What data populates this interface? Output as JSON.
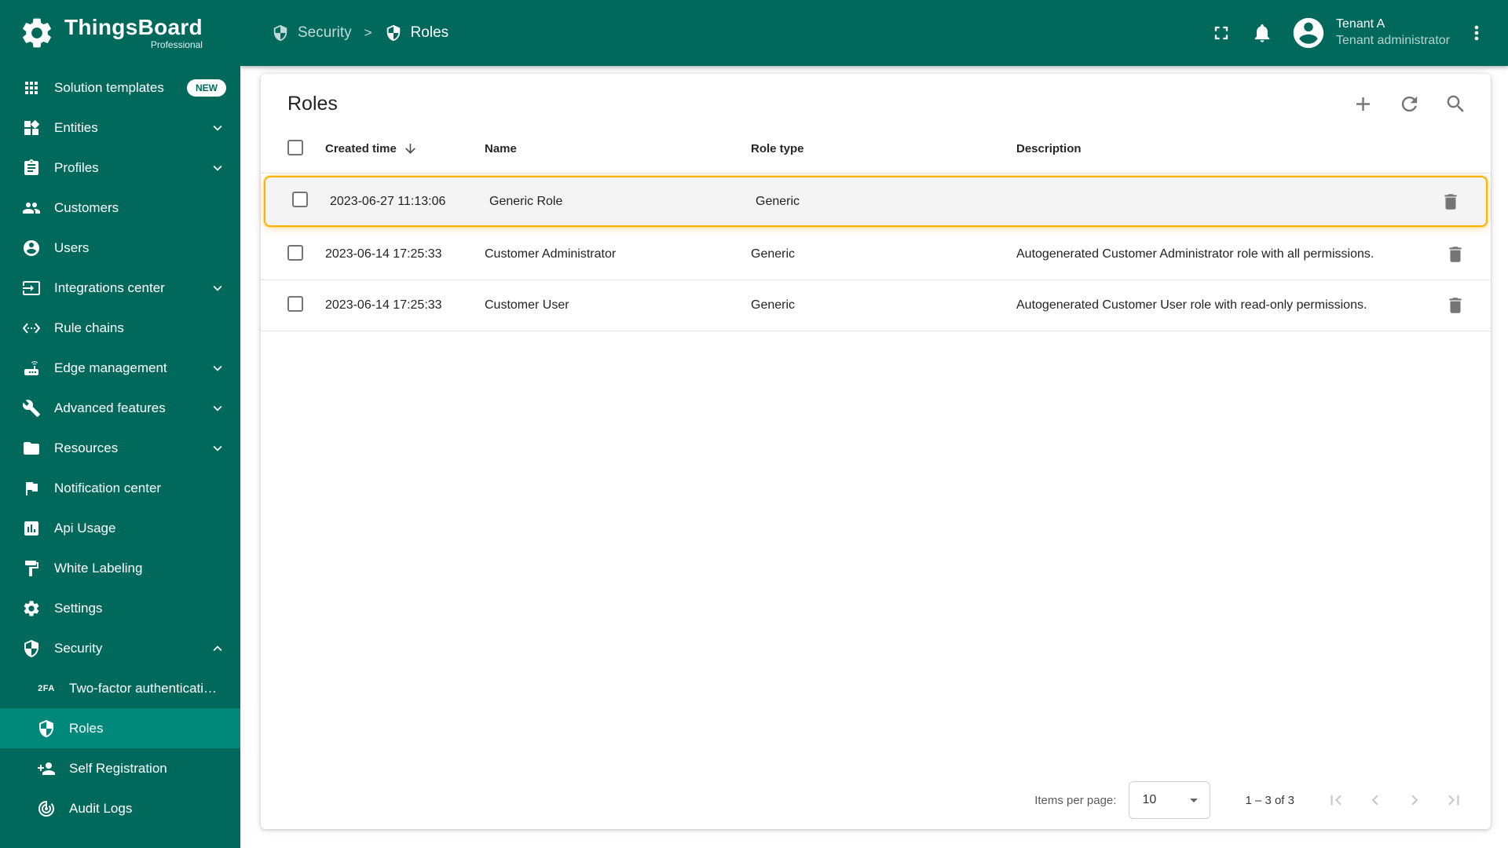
{
  "brand": {
    "name": "ThingsBoard",
    "subtitle": "Professional"
  },
  "header": {
    "breadcrumb": [
      {
        "label": "Security",
        "icon": "shield-icon"
      },
      {
        "label": "Roles",
        "icon": "shield-icon"
      }
    ],
    "separator": ">",
    "user": {
      "name": "Tenant A",
      "role": "Tenant administrator"
    }
  },
  "sidebar": {
    "items": [
      {
        "label": "Solution templates",
        "icon": "grid-icon",
        "badge": "NEW"
      },
      {
        "label": "Entities",
        "icon": "widgets-icon",
        "chevron": "down"
      },
      {
        "label": "Profiles",
        "icon": "assignment-icon",
        "chevron": "down"
      },
      {
        "label": "Customers",
        "icon": "people-icon"
      },
      {
        "label": "Users",
        "icon": "account-icon"
      },
      {
        "label": "Integrations center",
        "icon": "input-icon",
        "chevron": "down"
      },
      {
        "label": "Rule chains",
        "icon": "ethernet-icon"
      },
      {
        "label": "Edge management",
        "icon": "router-icon",
        "chevron": "down"
      },
      {
        "label": "Advanced features",
        "icon": "wrench-icon",
        "chevron": "down"
      },
      {
        "label": "Resources",
        "icon": "folder-icon",
        "chevron": "down"
      },
      {
        "label": "Notification center",
        "icon": "flag-icon"
      },
      {
        "label": "Api Usage",
        "icon": "chart-icon"
      },
      {
        "label": "White Labeling",
        "icon": "paint-icon"
      },
      {
        "label": "Settings",
        "icon": "gear-icon"
      },
      {
        "label": "Security",
        "icon": "shield-icon",
        "chevron": "up",
        "expanded": true,
        "sub": [
          {
            "label": "Two-factor authenticati…",
            "icon": "2fa-icon"
          },
          {
            "label": "Roles",
            "icon": "shield-icon",
            "active": true
          },
          {
            "label": "Self Registration",
            "icon": "person-add-icon"
          },
          {
            "label": "Audit Logs",
            "icon": "track-changes-icon"
          }
        ]
      }
    ]
  },
  "page": {
    "title": "Roles",
    "table": {
      "columns": [
        "Created time",
        "Name",
        "Role type",
        "Description"
      ],
      "sorted_column": "Created time",
      "sort_direction": "desc",
      "rows": [
        {
          "created": "2023-06-27 11:13:06",
          "name": "Generic Role",
          "type": "Generic",
          "description": "",
          "highlighted": true
        },
        {
          "created": "2023-06-14 17:25:33",
          "name": "Customer Administrator",
          "type": "Generic",
          "description": "Autogenerated Customer Administrator role with all permissions.",
          "highlighted": false
        },
        {
          "created": "2023-06-14 17:25:33",
          "name": "Customer User",
          "type": "Generic",
          "description": "Autogenerated Customer User role with read-only permissions.",
          "highlighted": false
        }
      ]
    },
    "pagination": {
      "items_per_page_label": "Items per page:",
      "page_size": "10",
      "range": "1 – 3 of 3"
    }
  },
  "icons": {
    "toolbar": [
      "add-icon",
      "refresh-icon",
      "search-icon"
    ],
    "row_action": "delete-icon",
    "topbar": [
      "fullscreen-icon",
      "bell-icon",
      "avatar-icon",
      "more-vert-icon"
    ],
    "sort": "sort-down-icon",
    "paginator": [
      "first-page-icon",
      "prev-page-icon",
      "next-page-icon",
      "last-page-icon"
    ]
  },
  "colors": {
    "primary_teal": "#00695C",
    "active_item_teal": "#00897B",
    "highlight_border": "#FFB300",
    "highlight_row_bg": "#F4F4F4",
    "icon_gray": "#757575",
    "disabled_gray": "#C9C9C9",
    "row_border": "#E6E6E6"
  }
}
